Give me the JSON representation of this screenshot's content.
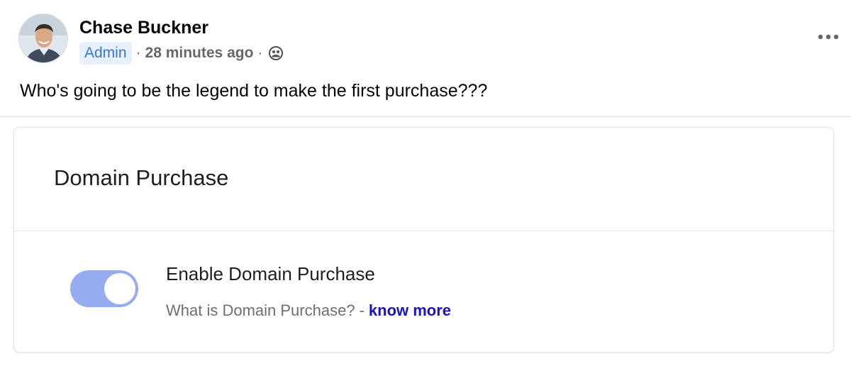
{
  "post": {
    "author": "Chase Buckner",
    "role_badge": "Admin",
    "separator": "·",
    "timestamp": "28 minutes ago",
    "privacy_icon": "group-audience-icon",
    "more_icon": "more-horizontal-icon",
    "body": "Who's going to be the legend to make the first purchase???"
  },
  "card": {
    "title": "Domain Purchase",
    "setting": {
      "label": "Enable Domain Purchase",
      "enabled": true,
      "help_text": "What is Domain Purchase?",
      "help_separator": "-",
      "link_text": "know more"
    }
  },
  "colors": {
    "badge_bg": "#e7f0fc",
    "badge_text": "#3476d8",
    "toggle_on": "#97abef",
    "link": "#1a12c7"
  }
}
